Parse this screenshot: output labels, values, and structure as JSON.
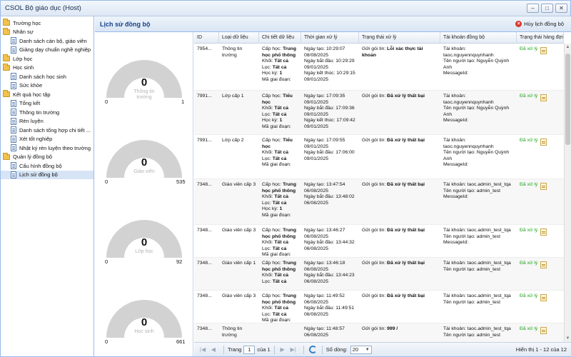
{
  "window": {
    "title": "CSOL Bộ giáo dục (Host)",
    "buttons": [
      "–",
      "□",
      "✕"
    ]
  },
  "sidebar": {
    "items": [
      {
        "label": "Trường học",
        "level": 0,
        "icon": "folder-icon"
      },
      {
        "label": "Nhân sự",
        "level": 0,
        "icon": "folder-icon"
      },
      {
        "label": "Danh sách cán bộ, giáo viên",
        "level": 1,
        "icon": "document-icon"
      },
      {
        "label": "Giảng dạy chuẩn nghề nghiệp",
        "level": 1,
        "icon": "document-icon"
      },
      {
        "label": "Lớp học",
        "level": 0,
        "icon": "folder-icon"
      },
      {
        "label": "Học sinh",
        "level": 0,
        "icon": "folder-icon"
      },
      {
        "label": "Danh sách học sinh",
        "level": 1,
        "icon": "document-icon"
      },
      {
        "label": "Sức khỏe",
        "level": 1,
        "icon": "document-icon"
      },
      {
        "label": "Kết quả học tập",
        "level": 0,
        "icon": "folder-icon"
      },
      {
        "label": "Tổng kết",
        "level": 1,
        "icon": "document-icon"
      },
      {
        "label": "Thông tin trường",
        "level": 1,
        "icon": "document-icon"
      },
      {
        "label": "Rèn luyện",
        "level": 1,
        "icon": "document-icon"
      },
      {
        "label": "Danh sách tổng hợp chi tiết ...",
        "level": 1,
        "icon": "document-icon"
      },
      {
        "label": "Xét tốt nghiệp",
        "level": 1,
        "icon": "document-icon"
      },
      {
        "label": "Nhật ký rèn luyện theo trường",
        "level": 1,
        "icon": "document-icon"
      },
      {
        "label": "Quản lý đồng bộ",
        "level": 0,
        "icon": "folder-icon"
      },
      {
        "label": "Cấu hình đồng bộ",
        "level": 1,
        "icon": "document-icon"
      },
      {
        "label": "Lịch sử đồng bộ",
        "level": 1,
        "icon": "document-icon",
        "selected": true
      }
    ]
  },
  "panel": {
    "title": "Lịch sử đồng bộ",
    "cancel_label": "Hủy lịch đồng bộ"
  },
  "gauges": [
    {
      "value": "0",
      "label": "Thông tin trường",
      "min": "0",
      "max": "1",
      "level": 0
    },
    {
      "value": "0",
      "label": "Giáo viên",
      "min": "0",
      "max": "535",
      "level": 0
    },
    {
      "value": "0",
      "label": "Lớp học",
      "min": "0",
      "max": "92",
      "level": 0
    },
    {
      "value": "0",
      "label": "Học sinh",
      "min": "0",
      "max": "661",
      "level": 0
    }
  ],
  "colors": {
    "gauge_track": "#d2d2d2",
    "success": "#1ea41e",
    "accent": "#15428b"
  },
  "grid": {
    "columns": [
      "ID",
      "Loại dữ liệu",
      "Chi tiết dữ liệu",
      "Thời gian xử lý",
      "Trạng thái xử lý",
      "Tài khoản đồng bộ",
      "Trạng thái hàng đợi"
    ],
    "rows": [
      {
        "id": "7954...",
        "type": "Thông tin trường",
        "detail": [
          [
            "Cấp học: ",
            "Trung học phổ thông"
          ],
          [
            "Khối: ",
            "Tất cả"
          ],
          [
            "Lọc: ",
            "Tất cả"
          ],
          [
            "Học kỳ: ",
            "1"
          ],
          [
            "Mã giai đoạn: ",
            ""
          ]
        ],
        "time": [
          [
            "Ngày tạo: ",
            "10:29:07 08/08/2025"
          ],
          [
            "Ngày bắt đầu: ",
            "10:29:29 09/01/2025"
          ],
          [
            "Ngày kết thúc: ",
            "10:29:15 09/01/2025"
          ]
        ],
        "status": [
          "Gửi gói tin: ",
          "Lỗi xác thực tài khoản"
        ],
        "account": [
          "Tài khoản: taoc.nguyennquynhanh",
          "Tên người tạo: Nguyễn Quỳnh Anh",
          "MessageId:"
        ],
        "queue": "Đã xử lý"
      },
      {
        "id": "7991...",
        "type": "Lớp cấp 1",
        "detail": [
          [
            "Cấp học: ",
            "Tiểu học"
          ],
          [
            "Khối: ",
            "Tất cả"
          ],
          [
            "Lọc: ",
            "Tất cả"
          ],
          [
            "Học kỳ: ",
            "1"
          ],
          [
            "Mã giai đoạn: ",
            ""
          ]
        ],
        "time": [
          [
            "Ngày tạo: ",
            "17:09:35 09/01/2025"
          ],
          [
            "Ngày bắt đầu: ",
            "17:09:36 09/01/2025"
          ],
          [
            "Ngày kết thúc: ",
            "17:09:42 09/01/2025"
          ]
        ],
        "status": [
          "Gửi gói tin: ",
          "Đã xử lý thất bại"
        ],
        "account": [
          "Tài khoản: taoc.nguyennquynhanh",
          "Tên người tạo: Nguyễn Quỳnh Anh",
          "MessageId:"
        ],
        "queue": "Đã xử lý"
      },
      {
        "id": "7991...",
        "type": "Lớp cấp 2",
        "detail": [
          [
            "Cấp học: ",
            "Tiểu học"
          ],
          [
            "Khối: ",
            "Tất cả"
          ],
          [
            "Lọc: ",
            "Tất cả"
          ],
          [
            "Mã giai đoạn: ",
            ""
          ]
        ],
        "time": [
          [
            "Ngày tạo: ",
            "17:09:55 09/01/2025"
          ],
          [
            "Ngày bắt đầu: ",
            "17:06:00 09/01/2025"
          ]
        ],
        "status": [
          "Gửi gói tin: ",
          "Đã xử lý thất bại"
        ],
        "account": [
          "Tài khoản: taoc.nguyennquynhanh",
          "Tên người tạo: Nguyễn Quỳnh Anh",
          "MessageId:"
        ],
        "queue": "Đã xử lý"
      },
      {
        "id": "7348...",
        "type": "Giáo viên cấp 3",
        "detail": [
          [
            "Cấp học: ",
            "Trung học phổ thông"
          ],
          [
            "Khối: ",
            "Tất cả"
          ],
          [
            "Lọc: ",
            "Tất cả"
          ],
          [
            "Học kỳ: ",
            "1"
          ],
          [
            "Mã giai đoạn: ",
            ""
          ]
        ],
        "time": [
          [
            "Ngày tạo: ",
            "13:47:54 06/08/2025"
          ],
          [
            "Ngày bắt đầu: ",
            "13:48:02 06/08/2025"
          ]
        ],
        "status": [
          "Gửi gói tin: ",
          "Đã xử lý thất bại"
        ],
        "account": [
          "Tài khoản: taoc.admin_test_tqa",
          "Tên người tạo: admin_test",
          "MessageId:"
        ],
        "queue": "Đã xử lý"
      },
      {
        "id": "7348...",
        "type": "Giáo viên cấp 3",
        "detail": [
          [
            "Cấp học: ",
            "Trung học phổ thông"
          ],
          [
            "Khối: ",
            "Tất cả"
          ],
          [
            "Lọc: ",
            "Tất cả"
          ],
          [
            "Mã giai đoạn: ",
            ""
          ]
        ],
        "time": [
          [
            "Ngày tạo: ",
            "13:46:27 06/08/2025"
          ],
          [
            "Ngày bắt đầu: ",
            "13:44:32 06/08/2025"
          ]
        ],
        "status": [
          "Gửi gói tin: ",
          "Đã xử lý thất bại"
        ],
        "account": [
          "Tài khoản: taoc.admin_test_tqa",
          "Tên người tạo: admin_test",
          "MessageId:"
        ],
        "queue": "Đã xử lý"
      },
      {
        "id": "7348...",
        "type": "Giáo viên cấp 1",
        "detail": [
          [
            "Cấp học: ",
            "Trung học phổ thông"
          ],
          [
            "Khối: ",
            "Tất cả"
          ],
          [
            "Lọc: ",
            "Tất cả"
          ]
        ],
        "time": [
          [
            "Ngày tạo: ",
            "13:46:18 06/08/2025"
          ],
          [
            "Ngày bắt đầu: ",
            "13:44:23 06/08/2025"
          ]
        ],
        "status": [
          "Gửi gói tin: ",
          "Đã xử lý thất bại"
        ],
        "account": [
          "Tài khoản: taoc.admin_test_tqa",
          "Tên người tạo: admin_test"
        ],
        "queue": "Đã xử lý"
      },
      {
        "id": "7348...",
        "type": "Giáo viên cấp 3",
        "detail": [
          [
            "Cấp học: ",
            "Trung học phổ thông"
          ],
          [
            "Khối: ",
            "Tất cả"
          ],
          [
            "Lọc: ",
            "Tất cả"
          ],
          [
            "Mã giai đoạn: ",
            ""
          ]
        ],
        "time": [
          [
            "Ngày tạo: ",
            "11:49:52 06/08/2025"
          ],
          [
            "Ngày bắt đầu: ",
            "11:49:51 06/08/2025"
          ]
        ],
        "status": [
          "Gửi gói tin: ",
          "Đã xử lý thất bại"
        ],
        "account": [
          "Tài khoản: taoc.admin_test_tqa",
          "Tên người tạo: admin_test"
        ],
        "queue": "Đã xử lý"
      },
      {
        "id": "7348...",
        "type": "Thông tin trường",
        "detail": [],
        "time": [
          [
            "Ngày tạo: ",
            "11:48:57 06/08/2025"
          ]
        ],
        "status": [
          "Gửi gói tin: ",
          "999 /"
        ],
        "account": [
          "Tài khoản: taoc.admin_test_tqa",
          "Tên người tạo: admin_test"
        ],
        "queue": "Đã xử lý"
      }
    ]
  },
  "pager": {
    "page_label": "Trang",
    "page_value": "1",
    "of_label": "của 1",
    "rows_label": "Số dòng:",
    "rows_value": "20",
    "info": "Hiển thị 1 - 12 của 12"
  }
}
